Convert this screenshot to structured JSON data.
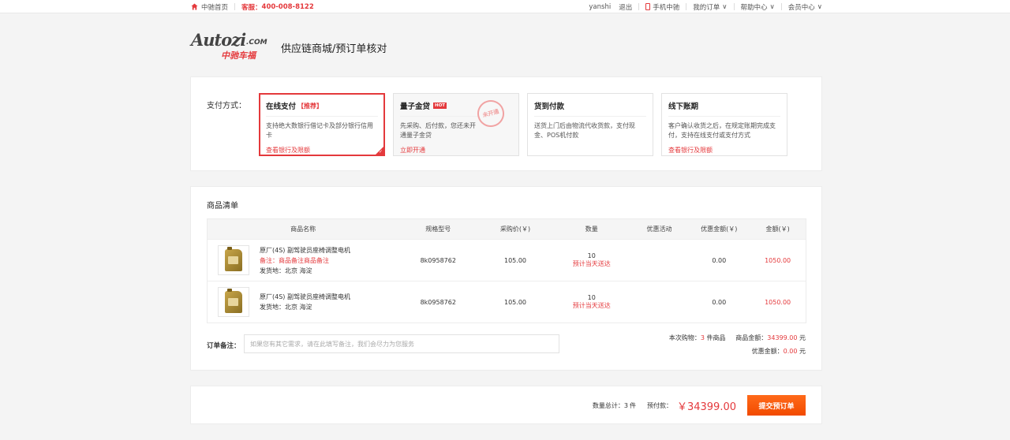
{
  "topbar": {
    "home": "中驰首页",
    "service_label": "客服：",
    "service_phone": "400-008-8122",
    "username": "yanshi",
    "logout": "退出",
    "mobile": "手机中驰",
    "my_orders": "我的订单",
    "help": "帮助中心",
    "member": "会员中心"
  },
  "header": {
    "logo_main": "Autozi",
    "logo_com": ".COM",
    "logo_cn": "中驰车福",
    "title": "供应链商城/预订单核对"
  },
  "payment": {
    "label": "支付方式：",
    "options": [
      {
        "title": "在线支付",
        "tag": "【推荐】",
        "desc": "支持绝大数银行借记卡及部分银行信用卡",
        "link": "查看银行及限额"
      },
      {
        "title": "量子金贷",
        "tag": "HOT",
        "desc": "先采购、后付款，您还未开通量子金贷",
        "link": "立即开通",
        "stamp": "未开通"
      },
      {
        "title": "货到付款",
        "desc": "送货上门后由物流代收货款，支付现金、POS机付款",
        "link": ""
      },
      {
        "title": "线下账期",
        "desc": "客户确认收货之后，在规定账期完成支付，支持在线支付或支付方式",
        "link": "查看银行及限额"
      }
    ]
  },
  "goods": {
    "title": "商品清单",
    "columns": [
      "商品名称",
      "规格型号",
      "采购价(￥)",
      "数量",
      "优惠活动",
      "优惠金额(￥)",
      "金额(￥)"
    ],
    "rows": [
      {
        "name": "原厂(4S) 副驾驶员座椅调整电机",
        "note": "备注：商品备注商品备注",
        "origin": "发货地：北京 海淀",
        "model": "8k0958762",
        "price": "105.00",
        "qty": "10",
        "qty_note": "预计当天送达",
        "promo": "",
        "discount": "0.00",
        "amount": "1050.00"
      },
      {
        "name": "原厂(4S) 副驾驶员座椅调整电机",
        "note": "",
        "origin": "发货地：北京 海淀",
        "model": "8k0958762",
        "price": "105.00",
        "qty": "10",
        "qty_note": "预计当天送达",
        "promo": "",
        "discount": "0.00",
        "amount": "1050.00"
      }
    ],
    "remark_label": "订单备注：",
    "remark_placeholder": "如果您有其它需求，请在此填写备注，我们会尽力为您服务",
    "summary": {
      "count_prefix": "本次购物：",
      "count": "3",
      "count_suffix": "件商品",
      "goods_amount_label": "商品金额：",
      "goods_amount": "34399.00",
      "unit": "元",
      "discount_label": "优惠金额：",
      "discount_amount": "0.00"
    }
  },
  "submit": {
    "total_qty_label": "数量总计：",
    "total_qty": "3",
    "qty_unit": "件",
    "pay_label": "预付款：",
    "pay_amount": "￥34399.00",
    "button": "提交预订单"
  },
  "colors": {
    "accent": "#e4393c",
    "button": "#f24a00"
  }
}
